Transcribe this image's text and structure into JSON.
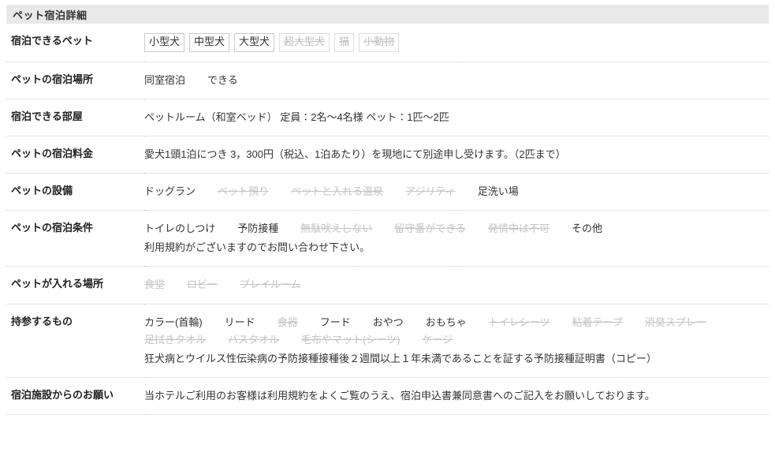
{
  "section": {
    "title": "ペット宿泊詳細"
  },
  "colors": {
    "header_bg": "#e9e9e9",
    "text": "#333333",
    "label_text": "#222222",
    "disabled_text": "#c4c4c4",
    "chip_border": "#cccccc",
    "divider": "#cccccc"
  },
  "rows": [
    {
      "label": "宿泊できるペット",
      "kind": "chips",
      "chips": [
        {
          "text": "小型犬",
          "available": true
        },
        {
          "text": "中型犬",
          "available": true
        },
        {
          "text": "大型犬",
          "available": true
        },
        {
          "text": "超大型犬",
          "available": false
        },
        {
          "text": "猫",
          "available": false
        },
        {
          "text": "小動物",
          "available": false
        }
      ]
    },
    {
      "label": "ペットの宿泊場所",
      "kind": "words",
      "words": [
        {
          "text": "同室宿泊",
          "available": true
        },
        {
          "text": "できる",
          "available": true
        }
      ]
    },
    {
      "label": "宿泊できる部屋",
      "kind": "text",
      "text": "ペットルーム（和室ベッド）  定員：2名〜4名様 ペット：1匹〜2匹"
    },
    {
      "label": "ペットの宿泊料金",
      "kind": "text",
      "text": "愛犬1頭1泊につき 3，300円（税込、1泊あたり）を現地にて別途申し受けます。（2匹まで）"
    },
    {
      "label": "ペットの設備",
      "kind": "words",
      "words": [
        {
          "text": "ドッグラン",
          "available": true
        },
        {
          "text": "ペット預り",
          "available": false
        },
        {
          "text": "ペットと入れる温泉",
          "available": false
        },
        {
          "text": "アジリティ",
          "available": false
        },
        {
          "text": "足洗い場",
          "available": true
        }
      ]
    },
    {
      "label": "ペットの宿泊条件",
      "kind": "words",
      "words": [
        {
          "text": "トイレのしつけ",
          "available": true
        },
        {
          "text": "予防接種",
          "available": true
        },
        {
          "text": "無駄吠えしない",
          "available": false
        },
        {
          "text": "留守番ができる",
          "available": false
        },
        {
          "text": "発情中は不可",
          "available": false
        },
        {
          "text": "その他",
          "available": true
        }
      ],
      "note": "利用規約がございますのでお問い合わせ下さい。"
    },
    {
      "label": "ペットが入れる場所",
      "kind": "words",
      "words": [
        {
          "text": "食堂",
          "available": false
        },
        {
          "text": "ロビー",
          "available": false
        },
        {
          "text": "プレイルーム",
          "available": false
        }
      ]
    },
    {
      "label": "持参するもの",
      "kind": "words",
      "words": [
        {
          "text": "カラー(首輪)",
          "available": true
        },
        {
          "text": "リード",
          "available": true
        },
        {
          "text": "食器",
          "available": false
        },
        {
          "text": "フード",
          "available": true
        },
        {
          "text": "おやつ",
          "available": true
        },
        {
          "text": "おもちゃ",
          "available": true
        },
        {
          "text": "トイレシーツ",
          "available": false
        },
        {
          "text": "粘着テープ",
          "available": false
        },
        {
          "text": "消臭スプレー",
          "available": false
        },
        {
          "text": "足拭きタオル",
          "available": false
        },
        {
          "text": "バスタオル",
          "available": false
        },
        {
          "text": "毛布やマット(シーツ)",
          "available": false
        },
        {
          "text": "ケージ",
          "available": false
        }
      ],
      "note": "狂犬病とウイルス性伝染病の予防接種接種後２週間以上１年未満であることを証する予防接種証明書（コピー）"
    },
    {
      "label": "宿泊施設からのお願い",
      "kind": "text",
      "text": "当ホテルご利用のお客様は利用規約をよくご覧のうえ、宿泊申込書兼同意書へのご記入をお願いしております。"
    }
  ]
}
